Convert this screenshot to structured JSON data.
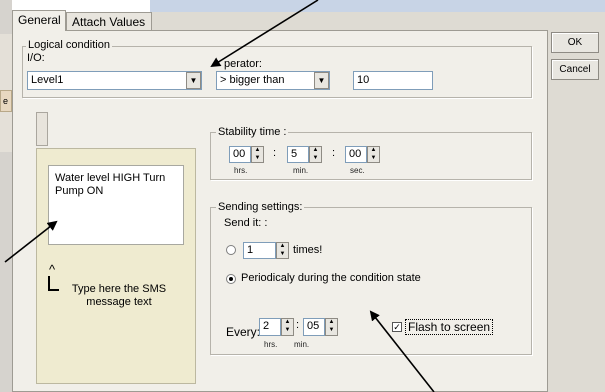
{
  "tabs": [
    {
      "label": "General"
    },
    {
      "label": "Attach Values"
    }
  ],
  "side_fragment": "e",
  "buttons": {
    "ok": "OK",
    "cancel": "Cancel"
  },
  "logical_condition": {
    "legend": "Logical condition",
    "io_label": "I/O:",
    "io_value": "Level1",
    "operator_label": "perator:",
    "operator_value": ">  bigger than",
    "threshold_value": "10"
  },
  "stability": {
    "legend": "Stability time :",
    "hrs": "00",
    "min": "5",
    "sec": "00",
    "sep1": ":",
    "sep2": ":",
    "hrs_label": "hrs.",
    "min_label": "min.",
    "sec_label": "sec."
  },
  "sms": {
    "message": "Water level HIGH Turn Pump ON",
    "caret": "^",
    "hint": "Type here the SMS message text"
  },
  "sending": {
    "legend": "Sending settings:",
    "send_it_label": "Send it: :",
    "times_value": "1",
    "times_label": "times!",
    "periodic_label": "Periodicaly during the condition state",
    "mode": "periodically",
    "every_label": "Every:",
    "every_hrs": "2",
    "every_min": "05",
    "every_sep": ":",
    "every_hrs_label": "hrs.",
    "every_min_label": "min.",
    "flash_label": "Flash to screen",
    "flash_checked": true
  },
  "icons": {
    "dropdown": "chevron-down-icon",
    "spinner": "spin-up-down-icon",
    "arrows": "annotation-arrow-icon"
  },
  "colors": {
    "dialog_bg": "#dedbd3",
    "page_bg": "#f1efe9",
    "sms_panel_bg": "#efebd0"
  }
}
